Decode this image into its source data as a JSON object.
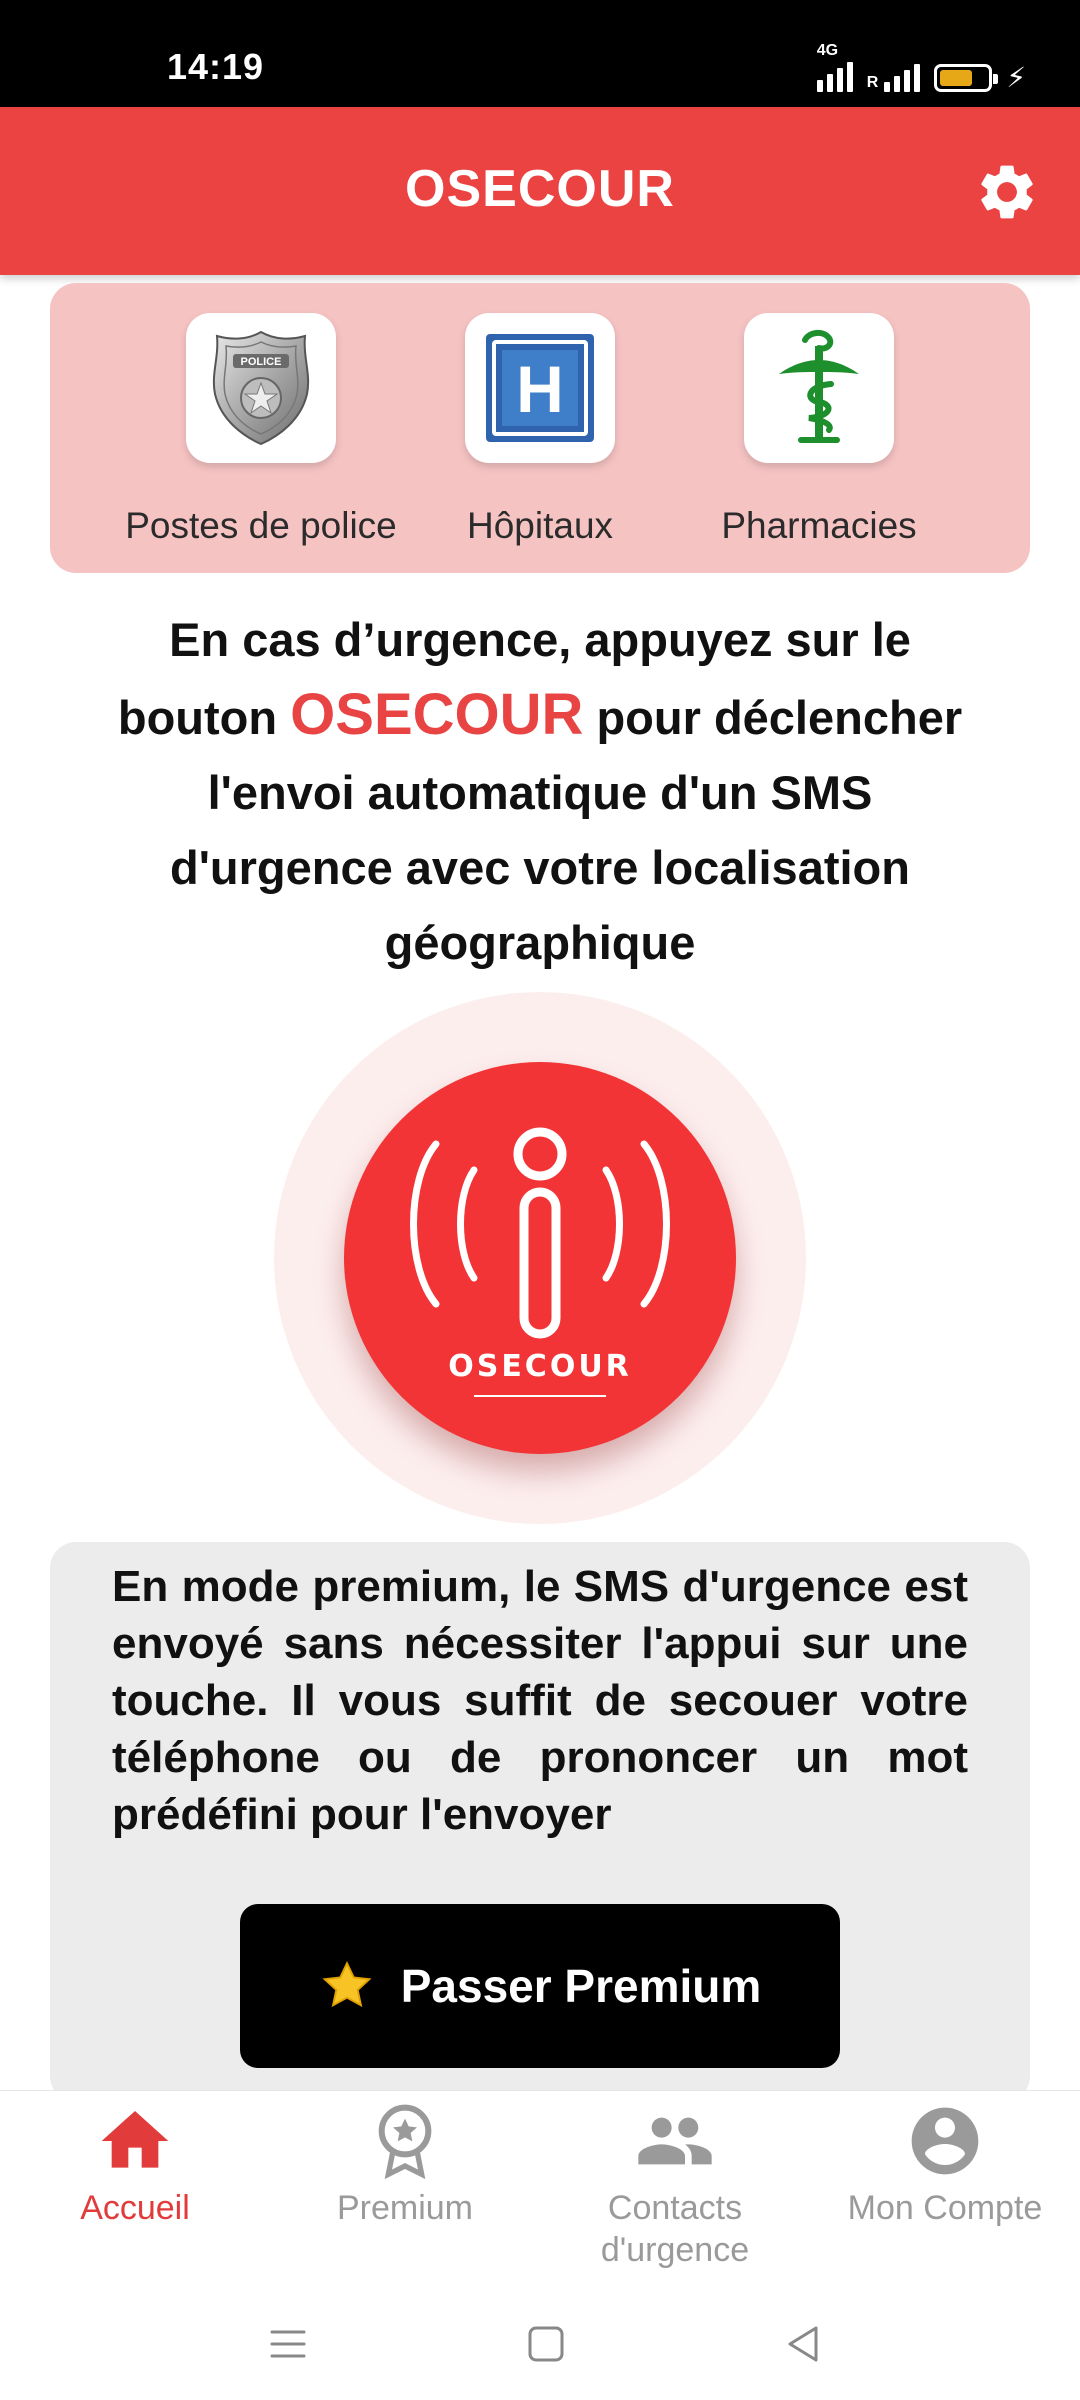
{
  "status_bar": {
    "time": "14:19",
    "network_label": "4G",
    "roaming_label": "R",
    "battery_level": 0.7,
    "charging": true
  },
  "app_bar": {
    "title": "OSECOUR",
    "settings_icon": "gear-icon"
  },
  "quick_access": {
    "items": [
      {
        "label": "Postes de police",
        "icon": "police-badge-icon"
      },
      {
        "label": "Hôpitaux",
        "icon": "hospital-icon"
      },
      {
        "label": "Pharmacies",
        "icon": "pharmacy-icon"
      }
    ],
    "police_badge_text": "POLICE",
    "hospital_letter": "H"
  },
  "instruction": {
    "part1": "En cas d’urgence, appuyez sur le bouton",
    "brand": "OSECOUR",
    "part2": "pour déclencher l'envoi automatique d'un SMS d'urgence avec votre localisation géographique"
  },
  "sos_button": {
    "label": "OSECOUR",
    "icon": "sos-alert-icon"
  },
  "premium": {
    "description": "En mode premium, le SMS d'urgence est envoyé sans nécessiter l'appui sur une touche. Il vous suffit de secouer votre téléphone ou de prononcer un mot prédéfini pour l'envoyer",
    "button_label": "Passer Premium",
    "button_icon": "star-icon"
  },
  "bottom_nav": {
    "items": [
      {
        "label": "Accueil",
        "icon": "home-icon",
        "active": true
      },
      {
        "label": "Premium",
        "icon": "award-icon",
        "active": false
      },
      {
        "label": "Contacts d'urgence",
        "icon": "people-icon",
        "active": false
      },
      {
        "label": "Mon Compte",
        "icon": "account-icon",
        "active": false
      }
    ]
  },
  "colors": {
    "primary": "#eb4242",
    "active_nav": "#e23b3b",
    "inactive_nav": "#9a9a9a",
    "quick_card_bg": "#f6c3c3",
    "premium_card_bg": "#ececec"
  }
}
